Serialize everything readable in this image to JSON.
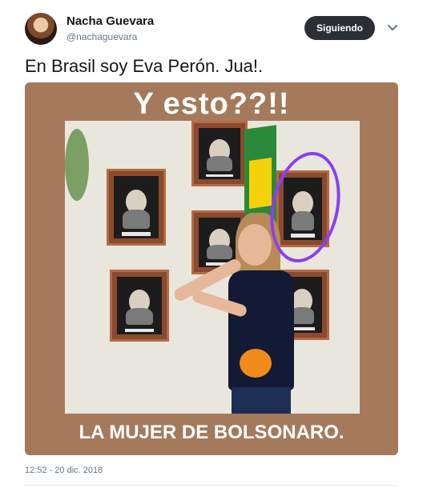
{
  "tweet": {
    "display_name": "Nacha Guevara",
    "handle": "@nachaguevara",
    "follow_label": "Siguiendo",
    "text": "En Brasil soy Eva Perón. Jua!.",
    "timestamp": "12:52 - 20 dic. 2018"
  },
  "media": {
    "caption_top": "Y esto??!!",
    "caption_bottom": "LA MUJER DE BOLSONARO.",
    "annotation_color": "#8a3ff0",
    "background_color": "#a57a5c"
  },
  "icons": {
    "more": "chevron-down-icon"
  },
  "colors": {
    "follow_button": "#2b2e33",
    "secondary_text": "#657786"
  }
}
